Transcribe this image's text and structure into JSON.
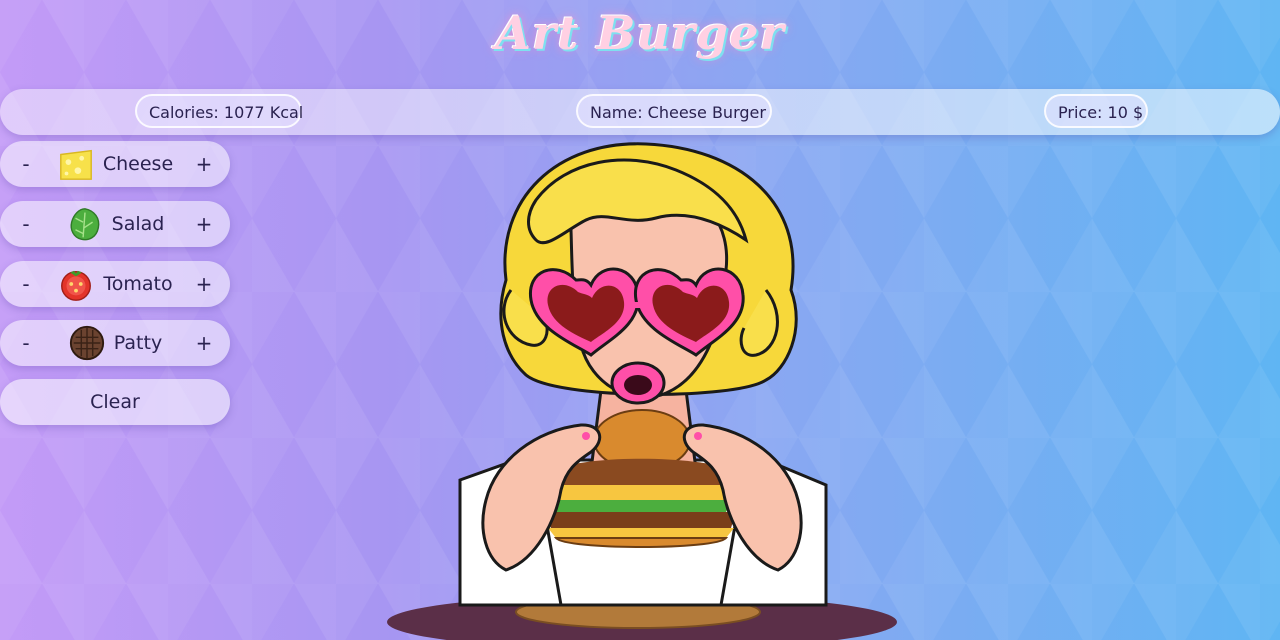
{
  "app": {
    "title": "Art Burger"
  },
  "info": {
    "calories": "Calories: 1077 Kcal",
    "name": "Name: Cheese Burger",
    "price": "Price: 10 $"
  },
  "ingredients": [
    {
      "label": "Cheese",
      "icon": "cheese-icon",
      "minus": "-",
      "plus": "+"
    },
    {
      "label": "Salad",
      "icon": "lettuce-icon",
      "minus": "-",
      "plus": "+"
    },
    {
      "label": "Tomato",
      "icon": "tomato-icon",
      "minus": "-",
      "plus": "+"
    },
    {
      "label": "Patty",
      "icon": "patty-icon",
      "minus": "-",
      "plus": "+"
    }
  ],
  "clear_label": "Clear",
  "colors": {
    "accent_pink": "#ff4fa8",
    "hair_yellow": "#f7d83a",
    "background_left": "#c39bf7",
    "background_right": "#5fb5f3"
  }
}
